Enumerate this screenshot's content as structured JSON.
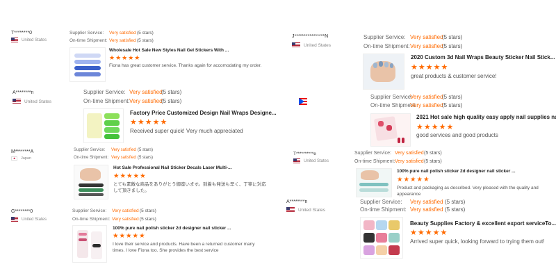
{
  "labels": {
    "supplier_service": "Supplier Service:",
    "ontime_shipment": "On-time Shipment:"
  },
  "colors": {
    "accent": "#ff6a00"
  },
  "reviews": [
    {
      "reviewer": "T********0",
      "country": "United States",
      "flag_icon": "us-flag-icon",
      "supplier_value": "Very satisfied",
      "supplier_stars": "(5 stars)",
      "shipment_value": "Very satisfied",
      "shipment_stars": "(5 stars)",
      "product_title": "Wholesale Hot Sale New Styles Nail Gel Stickers With ...",
      "stars": "★★★★★",
      "comment": "Fiona has great customer service. Thanks again for accomodating my order."
    },
    {
      "reviewer": "A********n",
      "country": "United States",
      "flag_icon": "us-flag-icon",
      "supplier_value": "Very satisfied",
      "supplier_stars": "(5 stars)",
      "shipment_value": "Very satisfied",
      "shipment_stars": "(5 stars)",
      "product_title": "Factory Price Customized Design Nail Wraps Designe...",
      "stars": "★★★★★",
      "comment": "Received super quick! Very much appreciated"
    },
    {
      "reviewer": "M********A",
      "country": "Japan",
      "flag_icon": "japan-flag-icon",
      "supplier_value": "Very satisfied",
      "supplier_stars": "(5 stars)",
      "shipment_value": "Very satisfied",
      "shipment_stars": "(5 stars)",
      "product_title": "Hot Sale Professional Nail Sticker Decals Laser Multi-...",
      "stars": "★★★★★",
      "comment": "とても素敵な商品をありがとう御座います。到着も発送も早く、丁寧に対応して頂きました。"
    },
    {
      "reviewer": "G********0",
      "country": "United States",
      "flag_icon": "us-flag-icon",
      "supplier_value": "Very satisfied",
      "supplier_stars": "(5 stars)",
      "shipment_value": "Very satisfied",
      "shipment_stars": "(5 stars)",
      "product_title": "100% pure nail polish sticker 2d designer nail sticker ...",
      "stars": "★★★★★",
      "comment": "I love their service and products. Have been a returned customer many times. I love Fiona too. She provides the best service"
    },
    {
      "reviewer": "J****************N",
      "country": "United States",
      "flag_icon": "us-flag-icon",
      "supplier_value": "Very satisfied",
      "supplier_stars": "(5 stars)",
      "shipment_value": "Very satisfied",
      "shipment_stars": "(5 stars)",
      "product_title": "2020 Custom 3d Nail Wraps Beauty Sticker Nail Stick...",
      "stars": "★★★★★",
      "comment": "great products & customer service!"
    },
    {
      "reviewer": "",
      "country": "",
      "flag_icon": "puerto-rico-flag-icon",
      "supplier_value": "Very satisfied",
      "supplier_stars": "(5 stars)",
      "shipment_value": "Very satisfied",
      "shipment_stars": "(5 stars)",
      "product_title": "2021 Hot sale high quality easy apply nail supplies na...",
      "stars": "★★★★★",
      "comment": "good services and good products"
    },
    {
      "reviewer": "T**********e",
      "country": "United States",
      "flag_icon": "us-flag-icon",
      "supplier_value": "Very satisfied",
      "supplier_stars": "(5 stars)",
      "shipment_value": "Very satisfied",
      "shipment_stars": "(5 stars)",
      "product_title": "100% pure nail polish sticker 2d designer nail sticker ...",
      "stars": "★★★★★",
      "comment": "Product and packaging as described. Very pleased with the quality and appearance"
    },
    {
      "reviewer": "A********n",
      "country": "United States",
      "flag_icon": "us-flag-icon",
      "supplier_value": "Very satisfied",
      "supplier_stars": "(5 stars)",
      "shipment_value": "Very satisfied",
      "shipment_stars": "(5 stars)",
      "product_title": "Beauty Supplies Factory & excellent export serviceTo...",
      "stars": "★★★★★",
      "comment": "Arrived super quick, looking forward to trying them out!"
    }
  ]
}
